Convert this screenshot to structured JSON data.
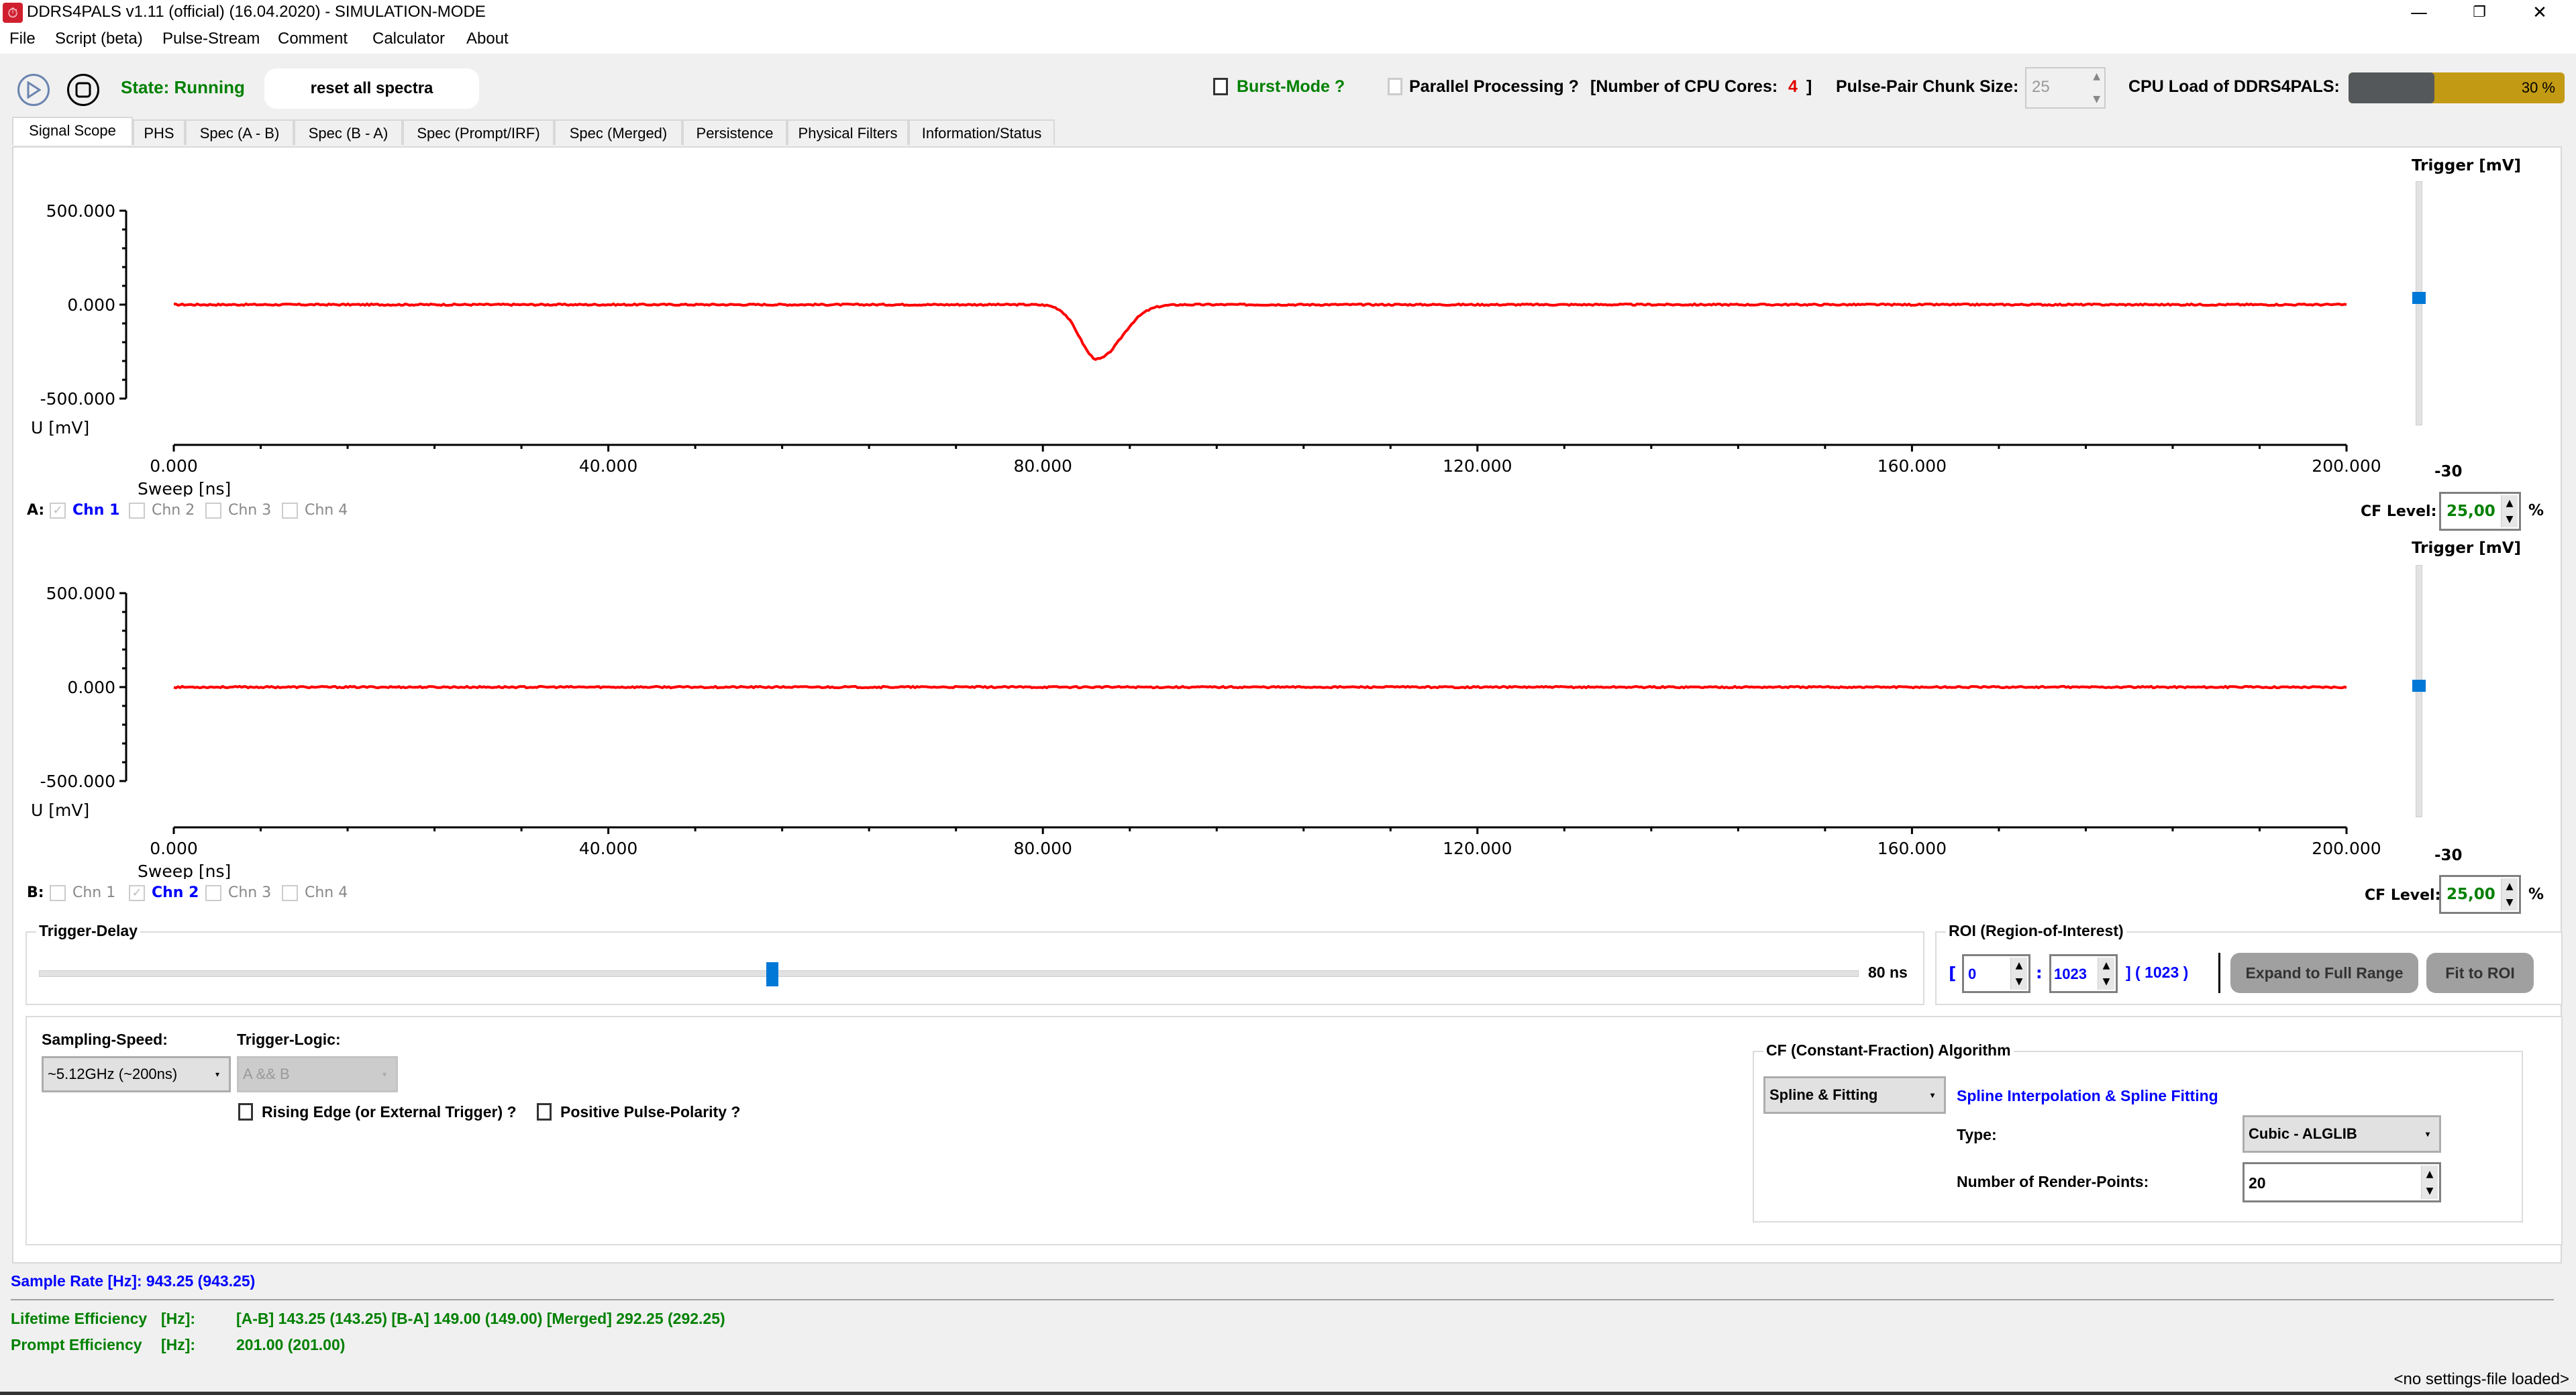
{
  "window": {
    "title": "DDRS4PALS v1.11 (official) (16.04.2020) - SIMULATION-MODE",
    "minimize_glyph": "—",
    "restore_glyph": "❐",
    "close_glyph": "✕"
  },
  "menu": [
    "File",
    "Script (beta)",
    "Pulse-Stream",
    "Comment",
    "Calculator",
    "About"
  ],
  "toolbar": {
    "state": "State: Running",
    "reset_label": "reset all spectra",
    "burst_mode_label": "Burst-Mode ?",
    "burst_mode_checked": false,
    "parallel_label": "Parallel Processing ?",
    "parallel_checked": false,
    "cpu_cores_label": "[Number of CPU Cores:",
    "cpu_cores_value": "4",
    "cpu_cores_close": "]",
    "chunk_label": "Pulse-Pair Chunk Size:",
    "chunk_value": "25",
    "cpu_load_label": "CPU Load of DDRS4PALS:",
    "cpu_load_text": "30 %",
    "cpu_load_percent": 30
  },
  "tabs": [
    {
      "label": "Signal Scope",
      "active": true
    },
    {
      "label": "PHS"
    },
    {
      "label": "Spec (A - B)"
    },
    {
      "label": "Spec (B - A)"
    },
    {
      "label": "Spec (Prompt/IRF)"
    },
    {
      "label": "Spec (Merged)"
    },
    {
      "label": "Persistence"
    },
    {
      "label": "Physical Filters"
    },
    {
      "label": "Information/Status"
    }
  ],
  "colors": {
    "trace": "#ff0000",
    "accent_blue": "#0078d7",
    "status_green": "#008000",
    "info_blue": "#0000ff",
    "cpu_bar": "#c39a14",
    "cpu_bar_bg": "#55585b"
  },
  "chart_data": [
    {
      "type": "line",
      "name": "scope-A",
      "xlabel": "Sweep [ns]",
      "ylabel": "U [mV]",
      "xlim": [
        0,
        200
      ],
      "ylim": [
        -500,
        500
      ],
      "x_ticks": [
        "0.000",
        "40.000",
        "80.000",
        "120.000",
        "160.000",
        "200.000"
      ],
      "x_tick_values": [
        0,
        40,
        80,
        120,
        160,
        200
      ],
      "y_ticks": [
        "500.000",
        "0.000",
        "-500.000"
      ],
      "y_tick_values": [
        500,
        0,
        -500
      ],
      "series": [
        {
          "name": "Chn 1",
          "baseline_mV": 0,
          "noise_mV": 4,
          "pulse": {
            "center_ns": 85,
            "amplitude_mV": -290,
            "rise_ns": 1.6,
            "fall_ns": 2.2
          }
        }
      ]
    },
    {
      "type": "line",
      "name": "scope-B",
      "xlabel": "Sweep [ns]",
      "ylabel": "U [mV]",
      "xlim": [
        0,
        200
      ],
      "ylim": [
        -500,
        500
      ],
      "x_ticks": [
        "0.000",
        "40.000",
        "80.000",
        "120.000",
        "160.000",
        "200.000"
      ],
      "x_tick_values": [
        0,
        40,
        80,
        120,
        160,
        200
      ],
      "y_ticks": [
        "500.000",
        "0.000",
        "-500.000"
      ],
      "y_tick_values": [
        500,
        0,
        -500
      ],
      "series": [
        {
          "name": "Chn 2",
          "baseline_mV": 0,
          "noise_mV": 4,
          "pulse": null
        }
      ]
    }
  ],
  "channelA": {
    "prefix": "A:",
    "channels": [
      {
        "label": "Chn 1",
        "checked": true
      },
      {
        "label": "Chn 2",
        "checked": false
      },
      {
        "label": "Chn 3",
        "checked": false
      },
      {
        "label": "Chn 4",
        "checked": false
      }
    ],
    "trigger_title": "Trigger [mV]",
    "trigger_value": "-30",
    "trigger_fraction": 0.48,
    "cf_label": "CF Level:",
    "cf_value": "25,00",
    "cf_unit": "%"
  },
  "channelB": {
    "prefix": "B:",
    "channels": [
      {
        "label": "Chn 1",
        "checked": false
      },
      {
        "label": "Chn 2",
        "checked": true
      },
      {
        "label": "Chn 3",
        "checked": false
      },
      {
        "label": "Chn 4",
        "checked": false
      }
    ],
    "trigger_title": "Trigger [mV]",
    "trigger_value": "-30",
    "trigger_fraction": 0.48,
    "cf_label": "CF Level:",
    "cf_value": "25,00",
    "cf_unit": "%"
  },
  "trigger_delay": {
    "title": "Trigger-Delay",
    "value_text": "80 ns",
    "fraction": 0.4
  },
  "roi": {
    "title": "ROI (Region-of-Interest)",
    "open_bracket": "[",
    "start": "0",
    "separator": ":",
    "end": "1023",
    "close": "] ( 1023 )",
    "expand_label": "Expand to Full Range",
    "fit_label": "Fit to ROI"
  },
  "settings": {
    "sampling_label": "Sampling-Speed:",
    "sampling_value": "~5.12GHz (~200ns)",
    "trigger_logic_label": "Trigger-Logic:",
    "trigger_logic_value": "A && B",
    "rising_edge_label": "Rising Edge (or External Trigger) ?",
    "rising_edge_checked": false,
    "positive_polarity_label": "Positive Pulse-Polarity ?",
    "positive_polarity_checked": false
  },
  "cf_algorithm": {
    "title": "CF (Constant-Fraction) Algorithm",
    "method_value": "Spline & Fitting",
    "method_desc": "Spline Interpolation & Spline Fitting",
    "type_label": "Type:",
    "type_value": "Cubic - ALGLIB",
    "render_points_label": "Number of Render-Points:",
    "render_points_value": "20"
  },
  "status": {
    "sample_rate": "Sample Rate [Hz]: 943.25 (943.25)",
    "lifetime_label": "Lifetime Efficiency",
    "lifetime_unit": "[Hz]:",
    "lifetime_value": "[A-B] 143.25 (143.25) [B-A] 149.00 (149.00) [Merged] 292.25 (292.25)",
    "prompt_label": "Prompt Efficiency",
    "prompt_unit": "[Hz]:",
    "prompt_value": "201.00 (201.00)",
    "settings_file": "<no settings-file loaded>"
  }
}
